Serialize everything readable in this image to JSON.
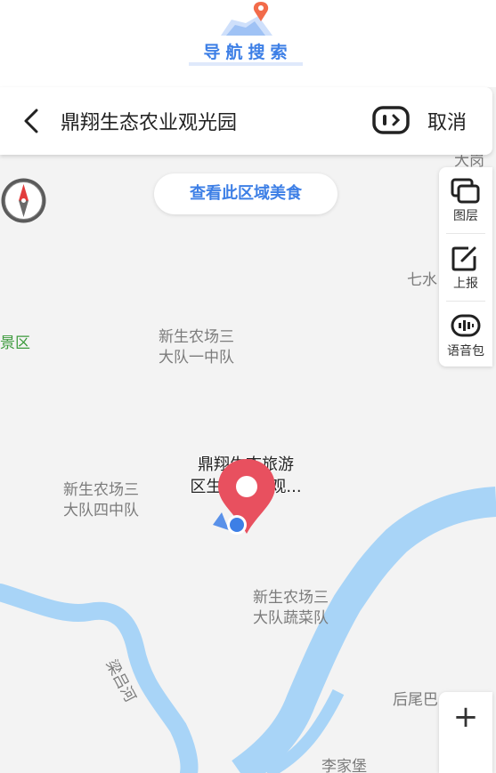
{
  "header": {
    "title": "导航搜索"
  },
  "search": {
    "query": "鼎翔生态农业观光园",
    "cancel_label": "取消"
  },
  "food_button": {
    "label": "查看此区域美食"
  },
  "tools": [
    {
      "label": "图层",
      "icon": "layers-icon"
    },
    {
      "label": "上报",
      "icon": "report-edit-icon"
    },
    {
      "label": "语音包",
      "icon": "voice-pack-icon"
    }
  ],
  "zoom": {
    "label": "+"
  },
  "map_labels": {
    "top_right": "大岗子",
    "qishui": "七水",
    "scenic": "景区",
    "team1": "新生农场三\n大队一中队",
    "team4": "新生农场三\n大队四中队",
    "veg": "新生农场三\n大队蔬菜队",
    "river": "梁吕河",
    "houwei": "后尾巴",
    "lijia": "李家堡"
  },
  "poi": {
    "name": "鼎翔生态旅游\n区生态农业观..."
  },
  "colors": {
    "accent": "#3d7fe6",
    "pin": "#e8505f",
    "river": "#a8d4f7",
    "map_bg": "#f3f3f3"
  }
}
